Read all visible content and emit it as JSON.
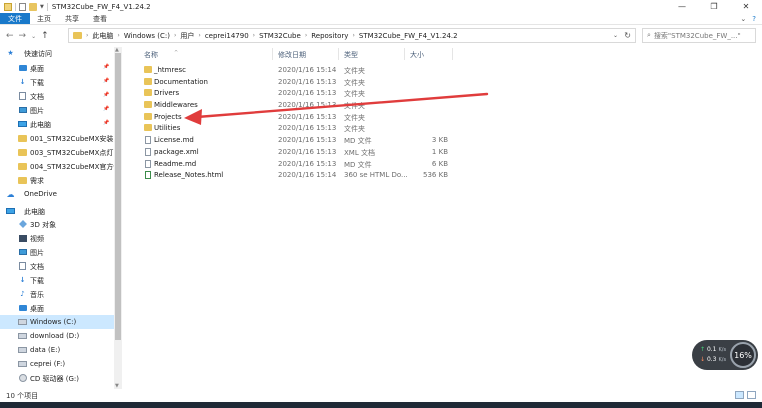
{
  "window": {
    "title": "STM32Cube_FW_F4_V1.24.2",
    "controls": [
      "—",
      "❐",
      "✕"
    ]
  },
  "ribbon": {
    "tabs": [
      "文件",
      "主页",
      "共享",
      "查看"
    ],
    "right": [
      "⌄",
      "?"
    ]
  },
  "address": {
    "segments": [
      "此电脑",
      "Windows (C:)",
      "用户",
      "ceprei14790",
      "STM32Cube",
      "Repository",
      "STM32Cube_FW_F4_V1.24.2"
    ],
    "search_placeholder": "搜索\"STM32Cube_FW_...\""
  },
  "sidebar": {
    "items": [
      {
        "label": "快速访问",
        "icon": "star-icon",
        "pinned": false
      },
      {
        "label": "桌面",
        "icon": "desktop-icon",
        "pinned": true
      },
      {
        "label": "下载",
        "icon": "download-icon",
        "pinned": true
      },
      {
        "label": "文档",
        "icon": "documents-icon",
        "pinned": true
      },
      {
        "label": "图片",
        "icon": "pictures-icon",
        "pinned": true
      },
      {
        "label": "此电脑",
        "icon": "computer-icon",
        "pinned": true
      },
      {
        "label": "001_STM32CubeMX安装",
        "icon": "folder-icon",
        "pinned": false
      },
      {
        "label": "003_STM32CubeMX点灯",
        "icon": "folder-icon",
        "pinned": false
      },
      {
        "label": "004_STM32CubeMX官方例",
        "icon": "folder-icon",
        "pinned": false
      },
      {
        "label": "需求",
        "icon": "folder-icon",
        "pinned": false
      },
      {
        "label": "OneDrive",
        "icon": "cloud-icon",
        "pinned": false
      },
      {
        "label": "此电脑",
        "icon": "computer-icon",
        "pinned": false
      },
      {
        "label": "3D 对象",
        "icon": "3d-objects-icon",
        "pinned": false
      },
      {
        "label": "视频",
        "icon": "video-icon",
        "pinned": false
      },
      {
        "label": "图片",
        "icon": "pictures-icon",
        "pinned": false
      },
      {
        "label": "文档",
        "icon": "documents-icon",
        "pinned": false
      },
      {
        "label": "下载",
        "icon": "download-icon",
        "pinned": false
      },
      {
        "label": "音乐",
        "icon": "music-icon",
        "pinned": false
      },
      {
        "label": "桌面",
        "icon": "desktop-icon",
        "pinned": false
      },
      {
        "label": "Windows (C:)",
        "icon": "drive-icon",
        "pinned": false
      },
      {
        "label": "download (D:)",
        "icon": "drive-icon",
        "pinned": false
      },
      {
        "label": "data (E:)",
        "icon": "drive-icon",
        "pinned": false
      },
      {
        "label": "ceprei (F:)",
        "icon": "drive-icon",
        "pinned": false
      },
      {
        "label": "CD 驱动器 (G:)",
        "icon": "cd-drive-icon",
        "pinned": false
      }
    ]
  },
  "columns": {
    "name": "名称",
    "date": "修改日期",
    "type": "类型",
    "size": "大小"
  },
  "files": [
    {
      "name": "_htmresc",
      "date": "2020/1/16 15:14",
      "type": "文件夹",
      "size": "",
      "kind": "folder"
    },
    {
      "name": "Documentation",
      "date": "2020/1/16 15:13",
      "type": "文件夹",
      "size": "",
      "kind": "folder"
    },
    {
      "name": "Drivers",
      "date": "2020/1/16 15:13",
      "type": "文件夹",
      "size": "",
      "kind": "folder"
    },
    {
      "name": "Middlewares",
      "date": "2020/1/16 15:13",
      "type": "文件夹",
      "size": "",
      "kind": "folder"
    },
    {
      "name": "Projects",
      "date": "2020/1/16 15:13",
      "type": "文件夹",
      "size": "",
      "kind": "folder"
    },
    {
      "name": "Utilities",
      "date": "2020/1/16 15:13",
      "type": "文件夹",
      "size": "",
      "kind": "folder"
    },
    {
      "name": "License.md",
      "date": "2020/1/16 15:13",
      "type": "MD 文件",
      "size": "3 KB",
      "kind": "file"
    },
    {
      "name": "package.xml",
      "date": "2020/1/16 15:13",
      "type": "XML 文档",
      "size": "1 KB",
      "kind": "file"
    },
    {
      "name": "Readme.md",
      "date": "2020/1/16 15:13",
      "type": "MD 文件",
      "size": "6 KB",
      "kind": "file"
    },
    {
      "name": "Release_Notes.html",
      "date": "2020/1/16 15:14",
      "type": "360 se HTML Do...",
      "size": "536 KB",
      "kind": "html"
    }
  ],
  "status": {
    "item_count": "10 个项目"
  },
  "netmon": {
    "upload": "0.1",
    "upload_unit": "K/s",
    "download": "0.3",
    "download_unit": "K/s",
    "percent": "16%"
  },
  "colors": {
    "accent": "#1979ca",
    "selected": "#cce8ff",
    "folder": "#e9c458",
    "annotation_arrow": "#e03c3c"
  }
}
